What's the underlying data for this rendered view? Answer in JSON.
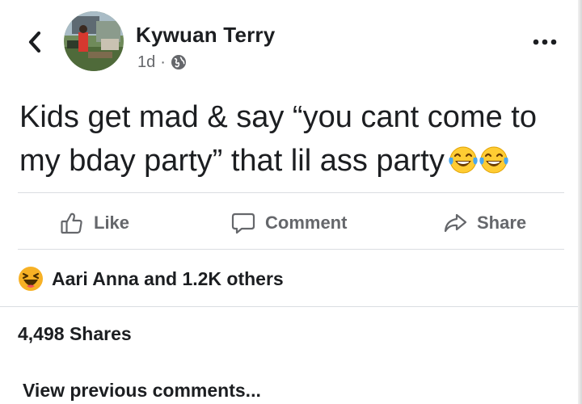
{
  "header": {
    "author_name": "Kywuan Terry",
    "timestamp": "1d",
    "separator": "·",
    "audience_icon": "globe-icon",
    "back_icon": "chevron-left-icon",
    "more_icon": "more-horizontal-icon"
  },
  "post": {
    "line1": "Kids get mad & say “you cant come to",
    "line2": "my bday party” that lil ass party",
    "emoji": "face-with-tears-of-joy"
  },
  "actions": {
    "like_label": "Like",
    "comment_label": "Comment",
    "share_label": "Share"
  },
  "reactions": {
    "summary": "Aari Anna and 1.2K others",
    "icon": "haha-reaction-icon"
  },
  "stats": {
    "shares": "4,498 Shares"
  },
  "comments": {
    "view_previous": "View previous comments..."
  },
  "colors": {
    "text": "#1c1e21",
    "secondary": "#65676b",
    "divider": "#dadde1",
    "reaction_yellow": "#f7b125"
  }
}
